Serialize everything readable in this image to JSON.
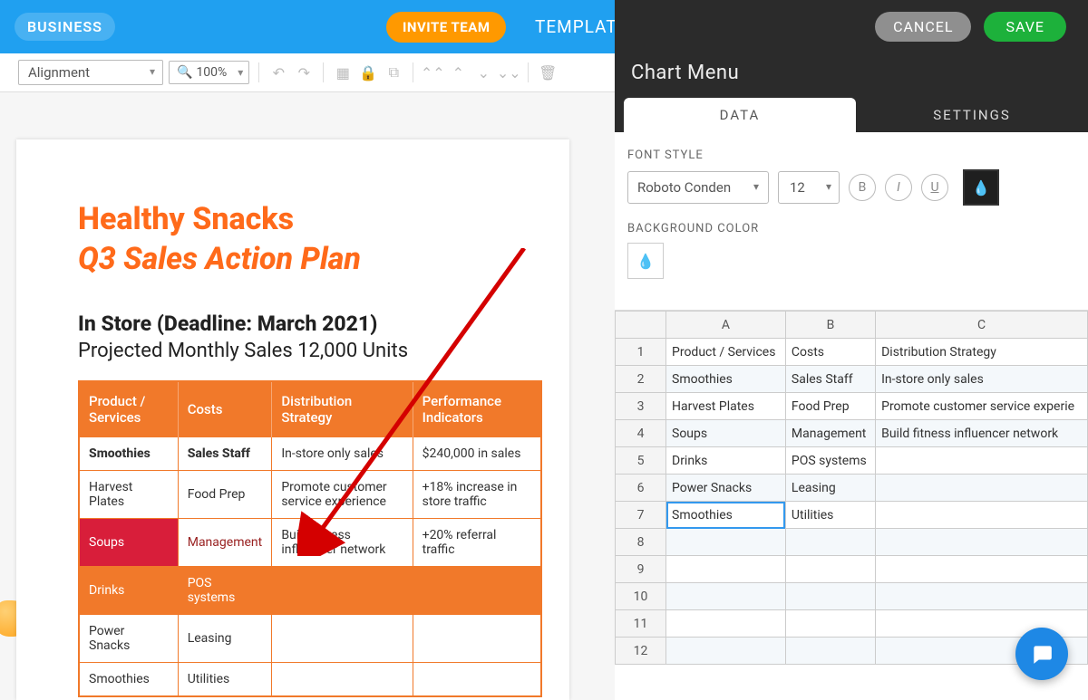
{
  "top": {
    "business": "BUSINESS",
    "invite": "INVITE TEAM",
    "templates": "TEMPLATE"
  },
  "toolbar": {
    "alignment": "Alignment",
    "zoom": "100%",
    "edit_table": "Edit Table"
  },
  "doc": {
    "title1": "Healthy Snacks",
    "title2": "Q3 Sales Action Plan",
    "heading": "In Store (Deadline: March 2021)",
    "proj": "Projected Monthly Sales 12,000 Units",
    "headers": [
      "Product / Services",
      "Costs",
      "Distribution Strategy",
      "Performance Indicators"
    ],
    "rows": [
      [
        "Smoothies",
        "Sales Staff",
        "In-store only sales",
        "$240,000 in sales"
      ],
      [
        "Harvest Plates",
        "Food Prep",
        "Promote customer service experience",
        "+18% increase in store traffic"
      ],
      [
        "Soups",
        "Management",
        "Build fitness influencer network",
        "+20% referral traffic"
      ],
      [
        "Drinks",
        "POS systems",
        "",
        ""
      ],
      [
        "Power Snacks",
        "Leasing",
        "",
        ""
      ],
      [
        "Smoothies",
        "Utilities",
        "",
        ""
      ]
    ]
  },
  "panel": {
    "cancel": "CANCEL",
    "save": "SAVE",
    "title": "Chart Menu",
    "tab_data": "DATA",
    "tab_settings": "SETTINGS",
    "font_style_label": "FONT STYLE",
    "font_name": "Roboto Conden",
    "font_size": "12",
    "bold": "B",
    "italic": "I",
    "underline": "U",
    "bg_label": "BACKGROUND COLOR"
  },
  "sheet": {
    "cols": [
      "A",
      "B",
      "C"
    ],
    "rows": [
      "1",
      "2",
      "3",
      "4",
      "5",
      "6",
      "7",
      "8",
      "9",
      "10",
      "11",
      "12"
    ],
    "data": {
      "1": [
        "Product / Services",
        "Costs",
        "Distribution Strategy"
      ],
      "2": [
        "Smoothies",
        "Sales Staff",
        "In-store only sales"
      ],
      "3": [
        "Harvest Plates",
        "Food Prep",
        "Promote customer service experie"
      ],
      "4": [
        "Soups",
        "Management",
        "Build fitness influencer network"
      ],
      "5": [
        "Drinks",
        "POS systems",
        ""
      ],
      "6": [
        "Power Snacks",
        "Leasing",
        ""
      ],
      "7": [
        "Smoothies",
        "Utilities",
        ""
      ]
    },
    "selected": {
      "row": "7",
      "col": 0
    }
  }
}
